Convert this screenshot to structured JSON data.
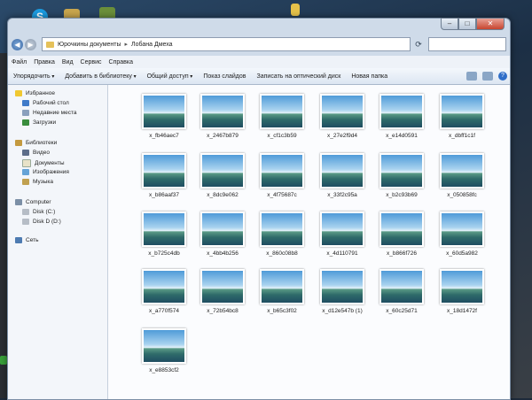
{
  "window": {
    "address": [
      "Юрочкины документы",
      "Лобана Дмеха"
    ]
  },
  "menu": [
    "Файл",
    "Правка",
    "Вид",
    "Сервис",
    "Справка"
  ],
  "toolbar": {
    "organize": "Упорядочить",
    "add_library": "Добавить в библиотеку",
    "share": "Общий доступ",
    "slideshow": "Показ слайдов",
    "burn": "Записать на оптический диск",
    "new_folder": "Новая папка"
  },
  "nav": {
    "favorites": "Избранное",
    "desktop": "Рабочий стол",
    "recent": "Недавние места",
    "downloads": "Загрузки",
    "libraries": "Библиотеки",
    "video": "Видео",
    "documents": "Документы",
    "images": "Изображения",
    "music": "Музыка",
    "computer": "Computer",
    "disk_c": "Disk (C:)",
    "disk_d": "Disk D (D:)",
    "network": "Сеть"
  },
  "files": [
    "x_fb46aec7",
    "x_2467b879",
    "x_cf1c3b59",
    "x_27e2f9d4",
    "x_e14d0591",
    "x_dbff1c1f",
    "x_b86aaf37",
    "x_8dc9e062",
    "x_4f75687c",
    "x_33f2c95a",
    "x_b2c93b69",
    "x_050858fc",
    "x_b725c4db",
    "x_4bb4b256",
    "x_860c08b8",
    "x_4d110791",
    "x_b866f726",
    "x_60d5a982",
    "x_a770f574",
    "x_72b54bc8",
    "x_b65c3f02",
    "x_d12e547b (1)",
    "x_60c25d71",
    "x_18d1472f",
    "x_e8853cf2"
  ]
}
